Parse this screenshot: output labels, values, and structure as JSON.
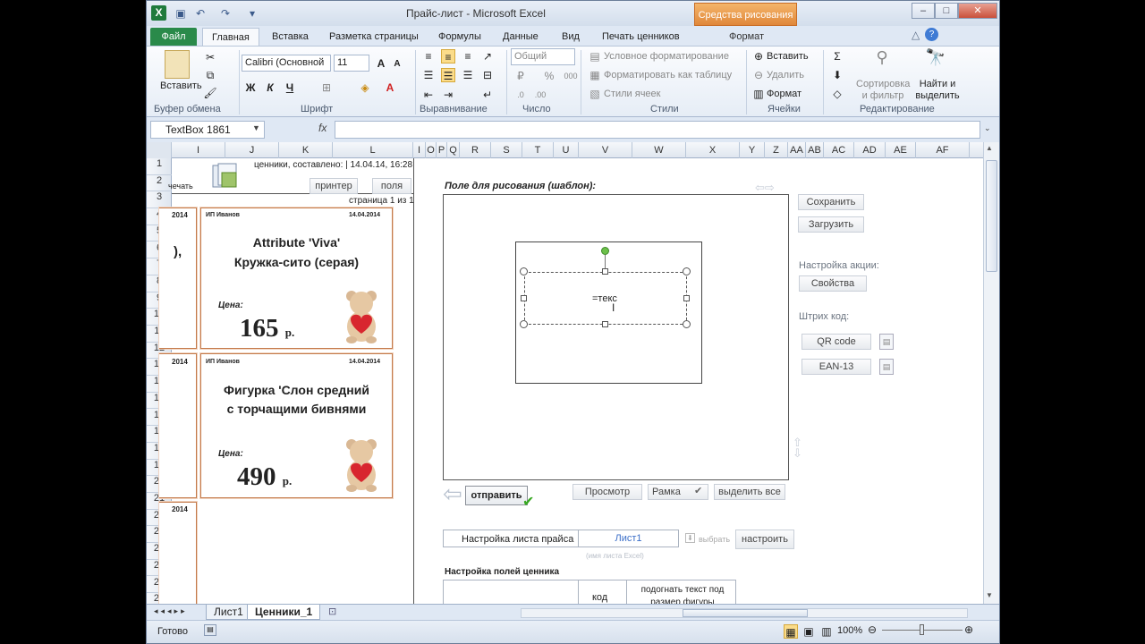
{
  "window": {
    "title": "Прайс-лист - Microsoft Excel",
    "context_tab": "Средства рисования",
    "controls": {
      "minimize": "–",
      "maximize": "□",
      "close": "✕"
    }
  },
  "tabs": [
    "Файл",
    "Главная",
    "Вставка",
    "Разметка страницы",
    "Формулы",
    "Данные",
    "Вид",
    "Печать ценников",
    "Формат"
  ],
  "ribbon": {
    "clipboard": {
      "paste": "Вставить",
      "label": "Буфер обмена"
    },
    "font": {
      "name": "Calibri (Основной",
      "size": "11",
      "bold": "Ж",
      "italic": "К",
      "underline": "Ч",
      "label": "Шрифт"
    },
    "alignment": {
      "label": "Выравнивание"
    },
    "number": {
      "format": "Общий",
      "label": "Число"
    },
    "styles": {
      "conditional": "Условное форматирование",
      "table": "Форматировать как таблицу",
      "cell_styles": "Стили ячеек",
      "label": "Стили"
    },
    "cells": {
      "insert": "Вставить",
      "delete": "Удалить",
      "format": "Формат",
      "label": "Ячейки"
    },
    "editing": {
      "sort": "Сортировка и фильтр",
      "find": "Найти и выделить",
      "label": "Редактирование"
    }
  },
  "formula_bar": {
    "name_box": "TextBox 1861",
    "fx": "fx",
    "value": ""
  },
  "columns": [
    "I",
    "J",
    "K",
    "L",
    "I",
    "O",
    "P",
    "Q",
    "R",
    "S",
    "T",
    "U",
    "V",
    "W",
    "X",
    "Y",
    "Z",
    "AA",
    "AB",
    "AC",
    "AD",
    "AE",
    "AF"
  ],
  "rows": [
    "1",
    "2",
    "3",
    "4",
    "5",
    "6",
    "7",
    "8",
    "9",
    "10",
    "11",
    "12",
    "13",
    "14",
    "15",
    "16",
    "17",
    "18",
    "19",
    "20",
    "21",
    "22",
    "23",
    "24",
    "25",
    "26",
    "27"
  ],
  "left_panel": {
    "print_fragment": "чечать",
    "compiled_text": "ценники, составлено: | 14.04.14, 16:28",
    "printer_btn": "принтер",
    "fields_btn": "поля",
    "page_text": "страница 1 из 1",
    "partial_date": "2014",
    "partial_mark": "),"
  },
  "price_tags": [
    {
      "seller": "ИП Иванов",
      "date": "14.04.2014",
      "name_line1": "Attribute 'Viva'",
      "name_line2": "Кружка-сито (серая)",
      "price_label": "Цена:",
      "price": "165",
      "currency": "р."
    },
    {
      "seller": "ИП Иванов",
      "date": "14.04.2014",
      "name_line1": "Фигурка 'Слон средний",
      "name_line2": "с торчащими бивнями",
      "price_label": "Цена:",
      "price": "490",
      "currency": "р."
    }
  ],
  "drawing": {
    "title": "Поле для рисования (шаблон):",
    "textbox_value": "=текс",
    "send_btn": "отправить",
    "preview_btn": "Просмотр",
    "frame_btn": "Рамка",
    "select_all_btn": "выделить все"
  },
  "right_panel": {
    "save_btn": "Сохранить",
    "load_btn": "Загрузить",
    "promo_label": "Настройка акции:",
    "properties_btn": "Свойства",
    "barcode_label": "Штрих код:",
    "qr_btn": "QR code",
    "ean_btn": "EAN-13"
  },
  "settings": {
    "sheet_label": "Настройка листа прайса",
    "sheet_value": "Лист1",
    "choose": "выбрать",
    "sheet_hint": "(имя листа Excel)",
    "configure_btn": "настроить",
    "fields_title": "Настройка полей ценника",
    "code_col": "код",
    "fit_col_line1": "подогнать текст под",
    "fit_col_line2": "размер фигуры"
  },
  "sheet_tabs": [
    "Лист1",
    "Ценники_1"
  ],
  "status": {
    "ready": "Готово",
    "zoom": "100%"
  }
}
